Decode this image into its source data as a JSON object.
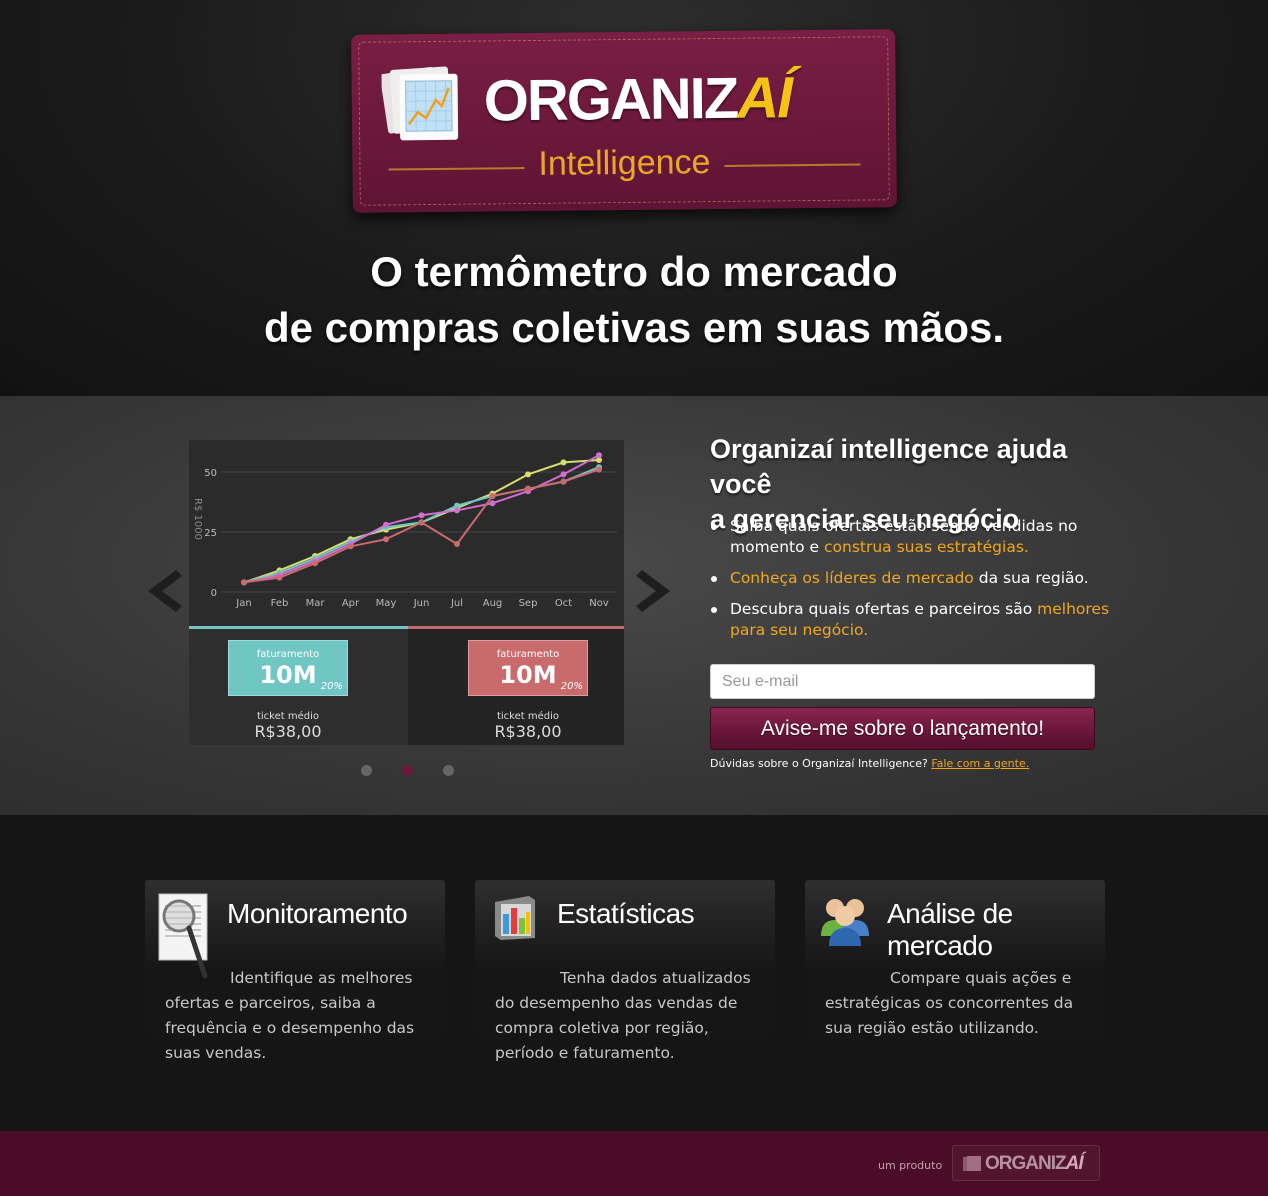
{
  "brand": {
    "logo_word": "ORGANIZ",
    "logo_accent": "AÍ",
    "logo_sub": "Intelligence",
    "accent_color": "#f5c216",
    "card_color": "#6b1a3c"
  },
  "hero": {
    "headline_line1": "O termômetro do mercado",
    "headline_line2": "de compras coletivas em suas mãos."
  },
  "slider": {
    "prev_icon": "chevron-left-icon",
    "next_icon": "chevron-right-icon",
    "active_slide": 2,
    "slides_count": 3,
    "kpis": [
      {
        "label": "faturamento",
        "value": "10M",
        "pct": "20%",
        "ticket_label": "ticket médio",
        "ticket_value": "R$38,00",
        "color": "#6fc6c3"
      },
      {
        "label": "faturamento",
        "value": "10M",
        "pct": "20%",
        "ticket_label": "ticket médio",
        "ticket_value": "R$38,00",
        "color": "#c96b6d"
      }
    ]
  },
  "chart_data": {
    "type": "line",
    "categories": [
      "Jan",
      "Feb",
      "Mar",
      "Apr",
      "May",
      "Jun",
      "Jul",
      "Aug",
      "Sep",
      "Oct",
      "Nov"
    ],
    "ylabel": "R$ 1000",
    "yticks": [
      0,
      25,
      50
    ],
    "ylim": [
      0,
      55
    ],
    "grid": true,
    "series": [
      {
        "color": "#d8de6a",
        "values": [
          4,
          9,
          15,
          22,
          26,
          29,
          35,
          41,
          49,
          54,
          55
        ]
      },
      {
        "color": "#6fc6c3",
        "values": [
          4,
          8,
          14,
          21,
          27,
          29,
          36,
          40,
          43,
          46,
          52
        ]
      },
      {
        "color": "#d06fd0",
        "values": [
          4,
          7,
          13,
          20,
          28,
          32,
          34,
          37,
          42,
          49,
          57
        ]
      },
      {
        "color": "#c96b6d",
        "values": [
          4,
          6,
          12,
          19,
          22,
          29,
          20,
          40,
          43,
          46,
          51
        ]
      }
    ]
  },
  "pitch": {
    "title_line1": "Organizaí intelligence ajuda você",
    "title_line2": "a gerenciar seu negócio",
    "bullets": [
      {
        "text": "Saiba quais ofertas estão sendo vendidas no momento e ",
        "highlight": "construa suas estratégias.",
        "after": ""
      },
      {
        "text": "",
        "highlight": "Conheça os líderes de mercado",
        "after": " da sua região."
      },
      {
        "text": "Descubra quais ofertas e parceiros são ",
        "highlight": "melhores para seu negócio.",
        "after": ""
      }
    ],
    "highlight_color": "#f0a81e"
  },
  "signup": {
    "email_placeholder": "Seu e-mail",
    "email_value": "",
    "cta_label": "Avise-me sobre o lançamento!",
    "help_text": "Dúvidas sobre o Organizaí Intelligence? ",
    "help_link": "Fale com a gente."
  },
  "features": [
    {
      "icon": "magnifier-document-icon",
      "title": "Monitoramento",
      "text": "Identifique as melhores ofertas e parceiros, saiba a frequência e o desempenho das suas vendas."
    },
    {
      "icon": "bar-chart-icon",
      "title": "Estatísticas",
      "text": "Tenha dados atualizados do desempenho das vendas de compra coletiva por região, período e faturamento."
    },
    {
      "icon": "users-icon",
      "title": "Análise de mercado",
      "text": "Compare quais ações e estratégicas os concorrentes da sua região estão utilizando."
    }
  ],
  "footer": {
    "by_text": "um produto",
    "logo_word": "ORGANIZ",
    "logo_accent": "AÍ",
    "bg_color": "#4a0c26"
  }
}
